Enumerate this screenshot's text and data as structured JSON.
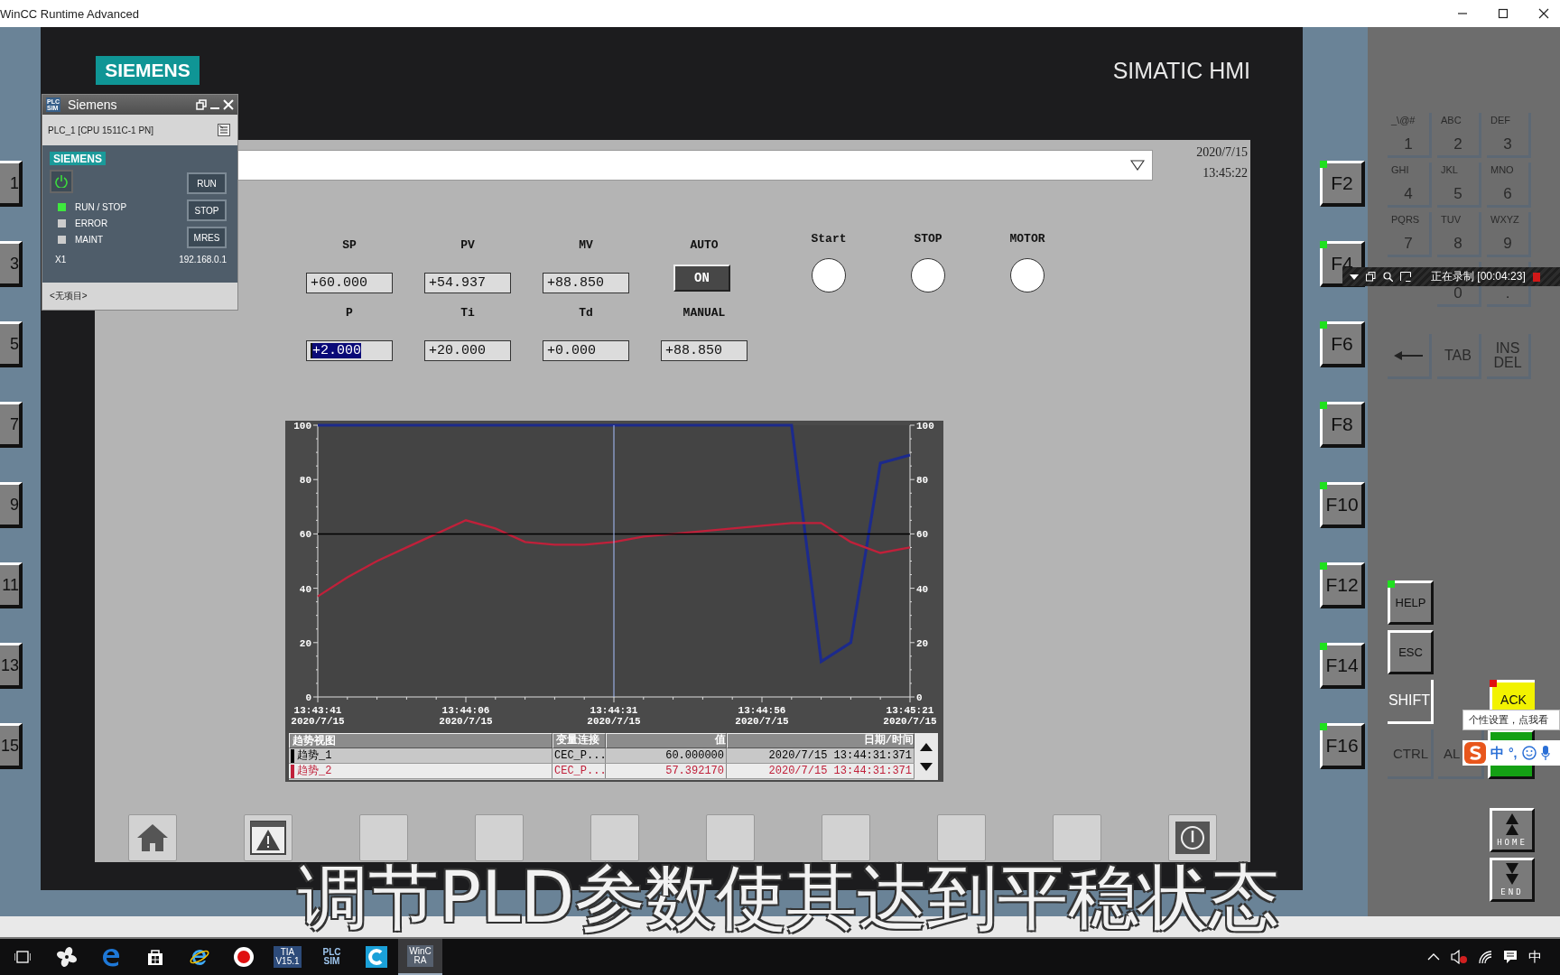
{
  "window": {
    "title": "WinCC Runtime Advanced"
  },
  "left_keys": [
    {
      "label": "1"
    },
    {
      "label": "3"
    },
    {
      "label": "5"
    },
    {
      "label": "7"
    },
    {
      "label": "9"
    },
    {
      "label": "11"
    },
    {
      "label": "13"
    },
    {
      "label": "15"
    }
  ],
  "panel": {
    "logo": "SIEMENS",
    "model": "SIMATIC HMI"
  },
  "screen": {
    "date": "2020/7/15",
    "time": "13:45:22",
    "params": [
      {
        "kind": "field",
        "label": "SP",
        "value": "+60.000",
        "selected": false
      },
      {
        "kind": "field",
        "label": "PV",
        "value": "+54.937",
        "selected": false
      },
      {
        "kind": "field",
        "label": "MV",
        "value": "+88.850",
        "selected": false
      },
      {
        "kind": "toggle",
        "label": "AUTO",
        "value": "ON",
        "on": true
      },
      {
        "kind": "field",
        "label": "P",
        "value": "+2.000",
        "selected": true
      },
      {
        "kind": "field",
        "label": "Ti",
        "value": "+20.000",
        "selected": false
      },
      {
        "kind": "field",
        "label": "Td",
        "value": "+0.000",
        "selected": false
      },
      {
        "kind": "field",
        "label": "MANUAL",
        "value": "+88.850",
        "selected": false
      }
    ],
    "indicators": [
      {
        "label": "Start",
        "on": false
      },
      {
        "label": "STOP",
        "on": false
      },
      {
        "label": "MOTOR",
        "on": false
      }
    ],
    "trend": {
      "chart_data": {
        "type": "line",
        "categories": [
          "13:43:41\n2020/7/15",
          null,
          null,
          null,
          null,
          "13:44:06\n2020/7/15",
          null,
          null,
          null,
          null,
          "13:44:31\n2020/7/15",
          null,
          null,
          null,
          null,
          "13:44:56\n2020/7/15",
          null,
          null,
          null,
          null,
          "13:45:21\n2020/7/15"
        ],
        "series": [
          {
            "color": "#000000",
            "values": [
              60,
              60,
              60,
              60,
              60,
              60,
              60,
              60,
              60,
              60,
              60,
              60,
              60,
              60,
              60,
              60,
              60,
              60,
              60,
              60,
              60
            ]
          },
          {
            "color": "#c0203a",
            "values": [
              37,
              44,
              50,
              55,
              60,
              65,
              62,
              57,
              56,
              56,
              57,
              59,
              60,
              61,
              62,
              63,
              64,
              64,
              57,
              53,
              55
            ]
          },
          {
            "color": "#1c2a8c",
            "values": [
              100,
              100,
              100,
              100,
              100,
              100,
              100,
              100,
              100,
              100,
              100,
              100,
              100,
              100,
              100,
              100,
              100,
              13,
              20,
              86,
              89
            ]
          }
        ],
        "ylim": [
          0,
          100
        ],
        "yticks": [
          0,
          20,
          40,
          60,
          80,
          100
        ],
        "ref_lines": [
          {
            "axis": "x",
            "value": "13:44:31\n2020/7/15"
          }
        ]
      },
      "right_axis": [
        "100",
        "80",
        "60",
        "40",
        "20",
        "0"
      ],
      "legend": {
        "columns": [
          "趋势视图",
          "变量连接",
          "值",
          "日期/时间"
        ],
        "rows": [
          {
            "selected": false,
            "cells": [
              "趋势_1",
              "CEC_P...",
              "60.000000",
              "2020/7/15  13:44:31:371"
            ]
          },
          {
            "selected": true,
            "cells": [
              "趋势_2",
              "CEC_P...",
              "57.392170",
              "2020/7/15  13:44:31:371"
            ]
          }
        ]
      }
    },
    "nav_buttons": [
      {
        "kind": "home"
      },
      {
        "kind": "alarm"
      },
      {
        "kind": "blank"
      },
      {
        "kind": "blank"
      },
      {
        "kind": "blank"
      },
      {
        "kind": "blank"
      },
      {
        "kind": "blank"
      },
      {
        "kind": "blank"
      },
      {
        "kind": "blank"
      },
      {
        "kind": "power"
      }
    ]
  },
  "function_keys": [
    {
      "label": "F2",
      "led": true
    },
    {
      "label": "F4",
      "led": true
    },
    {
      "label": "F6",
      "led": true
    },
    {
      "label": "F8",
      "led": true
    },
    {
      "label": "F10",
      "led": true
    },
    {
      "label": "F12",
      "led": true
    },
    {
      "label": "F14",
      "led": true
    },
    {
      "label": "F16",
      "led": true
    }
  ],
  "keypad": {
    "keys": [
      {
        "letters": "_\\@#",
        "digit": "1"
      },
      {
        "letters": "ABC",
        "digit": "2"
      },
      {
        "letters": "DEF",
        "digit": "3"
      },
      {
        "letters": "GHI",
        "digit": "4"
      },
      {
        "letters": "JKL",
        "digit": "5"
      },
      {
        "letters": "MNO",
        "digit": "6"
      },
      {
        "letters": "PQRS",
        "digit": "7"
      },
      {
        "letters": "TUV",
        "digit": "8"
      },
      {
        "letters": "WXYZ",
        "digit": "9"
      },
      {
        "digit": "0"
      },
      {
        "digit": "."
      }
    ],
    "edit_keys": [
      {
        "kind": "backspace"
      },
      {
        "kind": "text",
        "label": "TAB"
      },
      {
        "kind": "text",
        "label": "INS\nDEL"
      }
    ],
    "controls": [
      {
        "kind": "raised",
        "label": "HELP",
        "led": true
      },
      {
        "kind": "raised",
        "label": "ESC",
        "led": false
      },
      {
        "kind": "shift",
        "label": "SHIFT"
      },
      {
        "kind": "flat",
        "label": "CTRL"
      },
      {
        "kind": "flat",
        "label": "AL"
      },
      {
        "kind": "ack",
        "label": "ACK",
        "led": true
      },
      {
        "kind": "green"
      },
      {
        "kind": "home",
        "label": "HOME"
      },
      {
        "kind": "end",
        "label": "END"
      }
    ]
  },
  "plcsim": {
    "logo": "PLC\nSIM",
    "title": "Siemens",
    "device": "PLC_1 [CPU 1511C-1 PN]",
    "brand": "SIEMENS",
    "leds": [
      {
        "label": "RUN / STOP",
        "on": true
      },
      {
        "label": "ERROR",
        "on": false
      },
      {
        "label": "MAINT",
        "on": false
      }
    ],
    "buttons": [
      "RUN",
      "STOP",
      "MRES"
    ],
    "interface": "X1",
    "ip": "192.168.0.1",
    "project": "<无项目>"
  },
  "recorder": {
    "status": "正在录制 [00:04:23]"
  },
  "ime": {
    "tooltip": "个性设置，点我看",
    "mode": "中",
    "punct": "°,"
  },
  "subtitle": "调节PLD参数使其达到平稳状态",
  "taskbar": {
    "apps": [
      {
        "kind": "taskview",
        "selected": false
      },
      {
        "kind": "fan",
        "selected": false
      },
      {
        "kind": "edge",
        "selected": false
      },
      {
        "kind": "store",
        "selected": false
      },
      {
        "kind": "ie",
        "selected": false
      },
      {
        "kind": "record",
        "selected": false
      },
      {
        "kind": "tia",
        "label": "TIA\nV15.1",
        "selected": false
      },
      {
        "kind": "plcsim",
        "label": "PLC\nSIM",
        "selected": false
      },
      {
        "kind": "cloud",
        "selected": false
      },
      {
        "kind": "wincc",
        "label": "WinC\nRA",
        "selected": true
      }
    ],
    "input_mode": "中"
  }
}
